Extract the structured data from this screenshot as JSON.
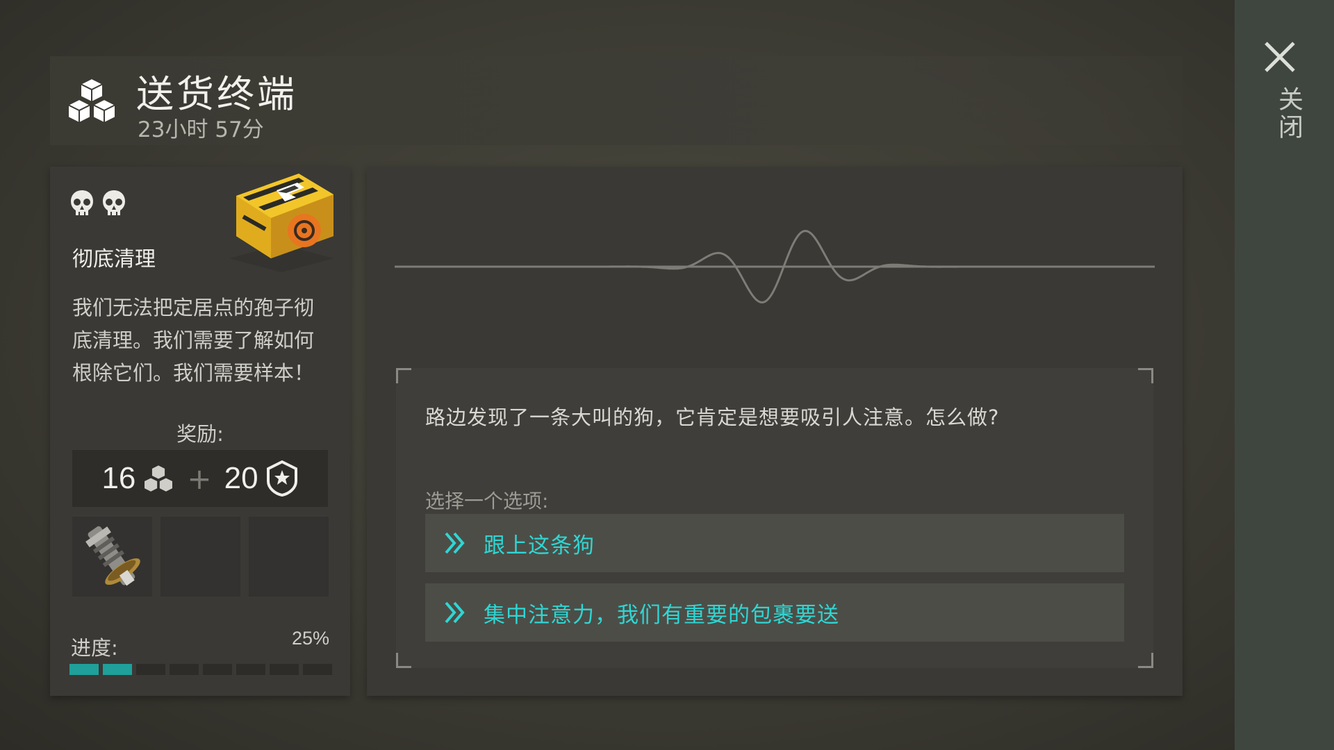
{
  "header": {
    "title": "送货终端",
    "timer": "23小时 57分",
    "icon": "boxes-icon"
  },
  "close": {
    "label": "关闭",
    "icon": "close-icon"
  },
  "mission": {
    "difficulty_icons": [
      "skull-icon",
      "skull-icon"
    ],
    "title": "彻底清理",
    "description": "我们无法把定居点的孢子彻底清理。我们需要了解如何根除它们。我们需要样本！",
    "reward_label": "奖励:",
    "reward": {
      "boxes": "16",
      "plus": "+",
      "reputation": "20"
    },
    "items": [
      "gear-shaft-item",
      "",
      ""
    ],
    "progress_label": "进度:",
    "progress_text": "25%",
    "progress_filled": 2,
    "progress_segments": 8
  },
  "dialog": {
    "text": "路边发现了一条大叫的狗，它肯定是想要吸引人注意。怎么做?",
    "choose_label": "选择一个选项:",
    "options": [
      {
        "label": "跟上这条狗"
      },
      {
        "label": "集中注意力，我们有重要的包裹要送"
      }
    ]
  },
  "colors": {
    "accent": "#2fd6d3",
    "progress": "#1fa09a",
    "panel": "#3a3935"
  }
}
